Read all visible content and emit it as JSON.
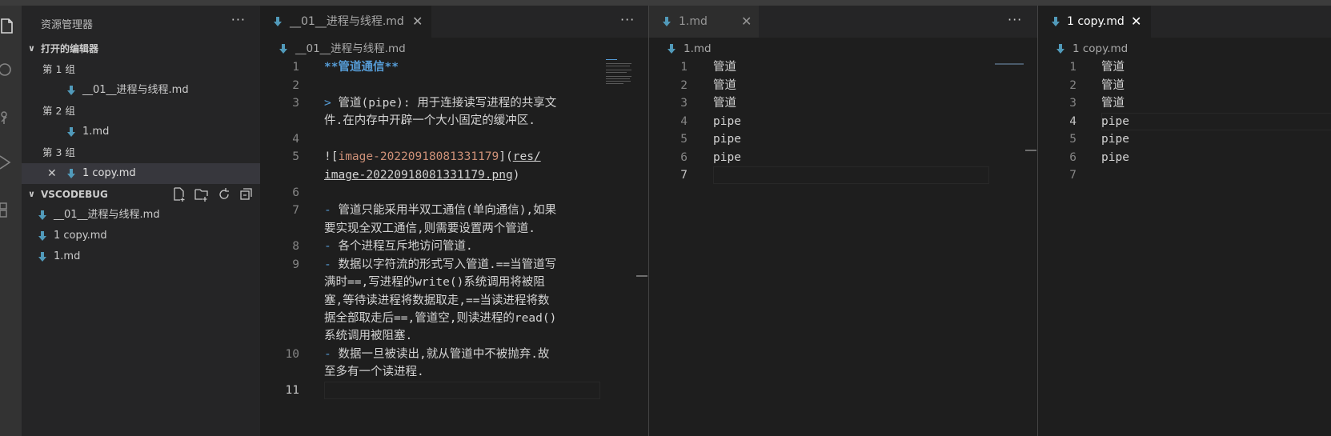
{
  "sidebar": {
    "title": "资源管理器",
    "more": "···",
    "open_editors": {
      "label": "打开的编辑器",
      "groups": [
        {
          "label": "第 1 组",
          "file": "__01__进程与线程.md"
        },
        {
          "label": "第 2 组",
          "file": "1.md"
        },
        {
          "label": "第 3 组",
          "file": "1 copy.md"
        }
      ]
    },
    "workspace": {
      "label": "VSCODEBUG",
      "files": [
        "__01__进程与线程.md",
        "1 copy.md",
        "1.md"
      ]
    }
  },
  "editor1": {
    "tab": "__01__进程与线程.md",
    "breadcrumb": "__01__进程与线程.md",
    "more": "···",
    "line_numbers": [
      "1",
      "2",
      "3",
      "4",
      "5",
      "6",
      "7",
      "8",
      "9",
      "10",
      "11"
    ],
    "l1": "**管道通信**",
    "l3a_marker": ">",
    "l3a": " 管道(pipe): 用于连接读写进程的共享文",
    "l3b": "件.在内存中开辟一个大小固定的缓冲区.",
    "l5a_open": "![",
    "l5a_alt": "image-20220918081331179",
    "l5a_mid": "](",
    "l5a_link": "res/",
    "l5b_link": "image-20220918081331179.png",
    "l5b_close": ")",
    "l7a_marker": "-",
    "l7a": " 管道只能采用半双工通信(单向通信),如果",
    "l7b": "要实现全双工通信,则需要设置两个管道.",
    "l8_marker": "-",
    "l8": " 各个进程互斥地访问管道.",
    "l9a_marker": "-",
    "l9a": " 数据以字符流的形式写入管道.==当管道写",
    "l9b": "满时==,写进程的write()系统调用将被阻",
    "l9c": "塞,等待读进程将数据取走,==当读进程将数",
    "l9d": "据全部取走后==,管道空,则读进程的read()",
    "l9e": "系统调用被阻塞.",
    "l10a_marker": "-",
    "l10a": " 数据一旦被读出,就从管道中不被抛弃.故",
    "l10b": "至多有一个读进程."
  },
  "editor2": {
    "tab": "1.md",
    "breadcrumb": "1.md",
    "more": "···",
    "lines": [
      "管道",
      "管道",
      "管道",
      "pipe",
      "pipe",
      "pipe",
      ""
    ],
    "line_numbers": [
      "1",
      "2",
      "3",
      "4",
      "5",
      "6",
      "7"
    ]
  },
  "editor3": {
    "tab": "1 copy.md",
    "breadcrumb": "1 copy.md",
    "lines": [
      "管道",
      "管道",
      "管道",
      "pipe",
      "pipe",
      "pipe",
      ""
    ],
    "line_numbers": [
      "1",
      "2",
      "3",
      "4",
      "5",
      "6",
      "7"
    ]
  },
  "icons": {
    "close": "✕",
    "chevron_down": "⌄",
    "md_color": "#519aba"
  }
}
